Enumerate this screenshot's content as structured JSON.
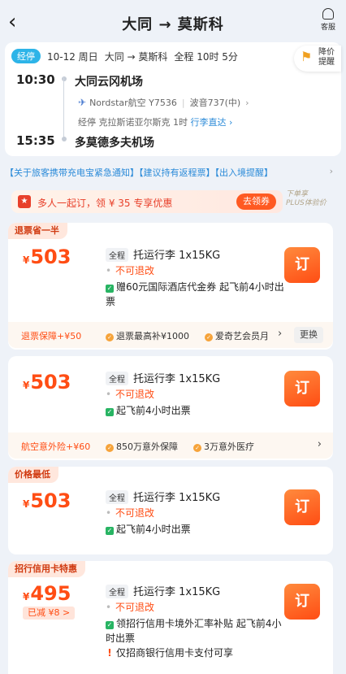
{
  "header": {
    "title": "大同 → 莫斯科",
    "service_label": "客服"
  },
  "flight_info": {
    "badge": "经停",
    "date": "10-12 周日",
    "route": "大同 → 莫斯科",
    "duration": "全程 10时 5分",
    "price_alert": "降价提醒",
    "dep_time": "10:30",
    "dep_airport": "大同云冈机场",
    "airline": "Nordstar航空 Y7536",
    "aircraft": "波音737(中)",
    "transit_text": "经停 克拉斯诺亚尔斯克 1时",
    "transit_link": "行李直达",
    "arr_time": "15:35",
    "arr_airport": "多莫德多夫机场"
  },
  "notice": {
    "text": "【关于旅客携带充电宝紧急通知】【建议持有返程票】【出入境提醒】"
  },
  "promo": {
    "text": "多人一起订，领 ¥ 35 专享优惠",
    "button": "去领券",
    "plus_line1": "下单享",
    "plus_line2": "PLUS体验价"
  },
  "offers": [
    {
      "tag": "退票省一半",
      "currency": "¥",
      "price": "503",
      "scope": "全程",
      "baggage": "托运行李 1x15KG",
      "refund": "不可退改",
      "check": "赠60元国际酒店代金券 起飞前4小时出票",
      "book": "订",
      "sub_label": "退票保障+¥50",
      "sub_item1": "退票最高补¥1000",
      "sub_item2": "爱奇艺会员月",
      "sub_change": "更换"
    },
    {
      "tag": "",
      "currency": "¥",
      "price": "503",
      "scope": "全程",
      "baggage": "托运行李 1x15KG",
      "refund": "不可退改",
      "check": "起飞前4小时出票",
      "book": "订",
      "sub_label": "航空意外险+¥60",
      "sub_item1": "850万意外保障",
      "sub_item2": "3万意外医疗"
    },
    {
      "tag": "价格最低",
      "currency": "¥",
      "price": "503",
      "scope": "全程",
      "baggage": "托运行李 1x15KG",
      "refund": "不可退改",
      "check": "起飞前4小时出票",
      "book": "订"
    },
    {
      "tag": "招行信用卡特惠",
      "currency": "¥",
      "price": "495",
      "discount": "已减 ¥8 >",
      "scope": "全程",
      "baggage": "托运行李 1x15KG",
      "refund": "不可退改",
      "check": "领招行信用卡境外汇率补贴 起飞前4小时出票",
      "warn": "仅招商银行信用卡支付可享",
      "book": "订"
    }
  ],
  "colors": {
    "accent": "#ff4d14",
    "link": "#2a8ad8",
    "badge": "#2db4e8"
  }
}
